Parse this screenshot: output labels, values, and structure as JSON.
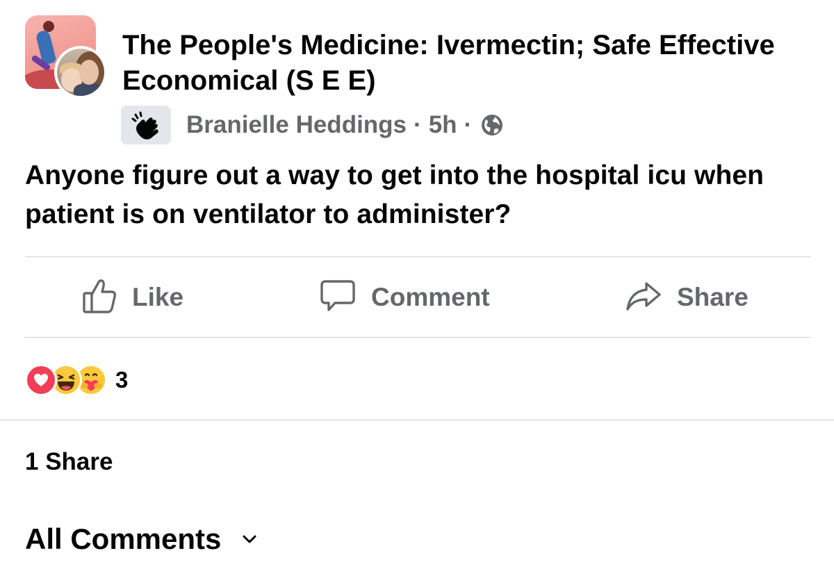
{
  "post": {
    "group_name": "The People's Medicine: Ivermectin; Safe Effective Economical (S E E)",
    "author": "Branielle Heddings",
    "separator": "·",
    "time": "5h",
    "privacy_icon": "globe-icon",
    "badge_icon": "waving-hand-icon",
    "text": "Anyone figure out a way to get into the hospital icu when patient is on ventilator to administer?"
  },
  "actions": {
    "like_label": "Like",
    "comment_label": "Comment",
    "share_label": "Share"
  },
  "reactions": {
    "icons": [
      "love-reaction-icon",
      "haha-reaction-icon",
      "care-reaction-icon"
    ],
    "count": "3"
  },
  "shares": {
    "label": "1 Share"
  },
  "comments": {
    "label": "All Comments",
    "chevron_icon": "chevron-down-icon"
  },
  "colors": {
    "text_primary": "#050505",
    "text_secondary": "#65676b",
    "divider": "#ced0d4",
    "love": "#f33e58",
    "haha": "#f7b125"
  }
}
